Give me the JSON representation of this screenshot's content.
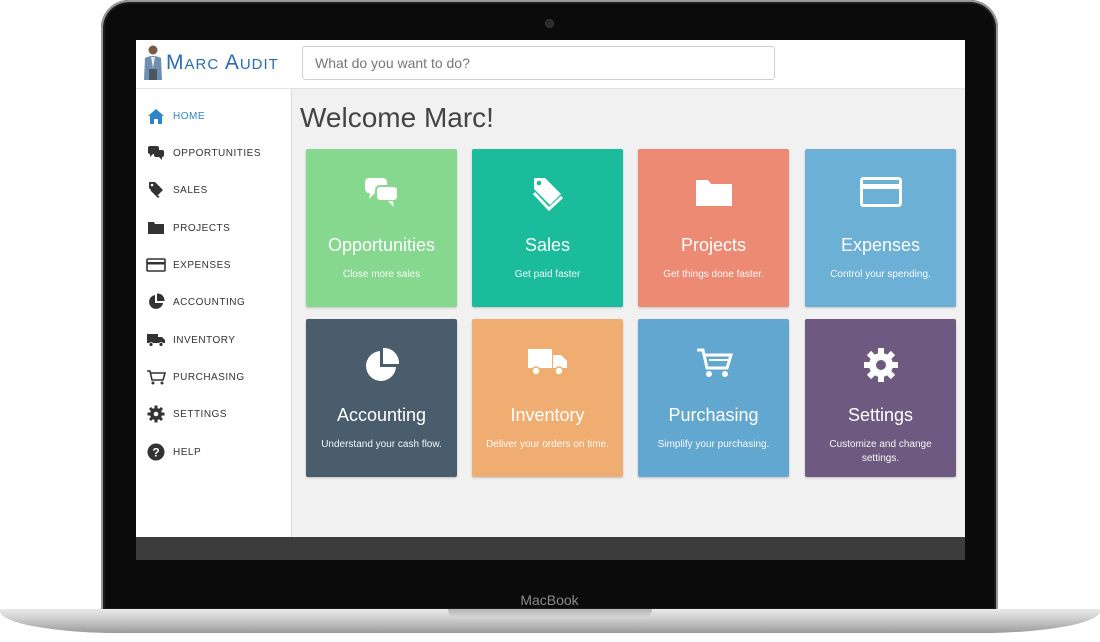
{
  "app": {
    "logo_text": "Marc Audit",
    "search_placeholder": "What do you want to do?"
  },
  "sidebar": {
    "items": [
      {
        "label": "HOME",
        "icon": "home-icon",
        "active": true
      },
      {
        "label": "OPPORTUNITIES",
        "icon": "chat-bubbles-icon"
      },
      {
        "label": "SALES",
        "icon": "tags-icon"
      },
      {
        "label": "PROJECTS",
        "icon": "folder-icon"
      },
      {
        "label": "EXPENSES",
        "icon": "credit-card-icon"
      },
      {
        "label": "ACCOUNTING",
        "icon": "pie-chart-icon"
      },
      {
        "label": "INVENTORY",
        "icon": "truck-icon"
      },
      {
        "label": "PURCHASING",
        "icon": "cart-icon"
      },
      {
        "label": "SETTINGS",
        "icon": "gear-icon"
      },
      {
        "label": "HELP",
        "icon": "help-icon"
      }
    ]
  },
  "main": {
    "welcome": "Welcome Marc!",
    "tiles": [
      {
        "title": "Opportunities",
        "subtitle": "Close more sales",
        "color": "#86d88f",
        "icon": "chat-bubbles-icon"
      },
      {
        "title": "Sales",
        "subtitle": "Get paid faster",
        "color": "#1abc9c",
        "icon": "tags-icon"
      },
      {
        "title": "Projects",
        "subtitle": "Get things done faster.",
        "color": "#ec8a74",
        "icon": "folder-icon"
      },
      {
        "title": "Expenses",
        "subtitle": "Control your spending.",
        "color": "#6cb0d6",
        "icon": "credit-card-icon"
      },
      {
        "title": "Accounting",
        "subtitle": "Understand your cash flow.",
        "color": "#4a5d6c",
        "icon": "pie-chart-icon"
      },
      {
        "title": "Inventory",
        "subtitle": "Deliver your orders on time.",
        "color": "#f0ad72",
        "icon": "truck-icon"
      },
      {
        "title": "Purchasing",
        "subtitle": "Simplify your purchasing.",
        "color": "#62a7d0",
        "icon": "cart-icon"
      },
      {
        "title": "Settings",
        "subtitle": "Customize and change settings.",
        "color": "#6e5a80",
        "icon": "gear-icon"
      }
    ]
  },
  "device": {
    "label": "MacBook"
  }
}
